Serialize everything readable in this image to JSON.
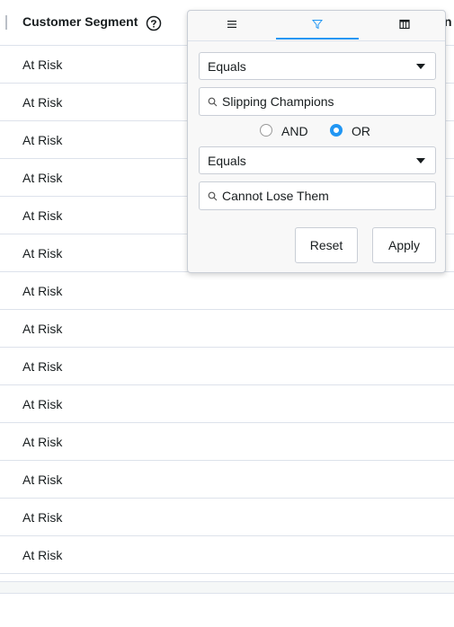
{
  "header": {
    "column_title": "Customer Segment",
    "next_column_partial": "n"
  },
  "rows": [
    "At Risk",
    "At Risk",
    "At Risk",
    "At Risk",
    "At Risk",
    "At Risk",
    "At Risk",
    "At Risk",
    "At Risk",
    "At Risk",
    "At Risk",
    "At Risk",
    "At Risk",
    "At Risk"
  ],
  "filter_popup": {
    "tabs": [
      {
        "icon": "menu-icon",
        "active": false
      },
      {
        "icon": "filter-icon",
        "active": true
      },
      {
        "icon": "columns-icon",
        "active": false
      }
    ],
    "condition1": {
      "operator": "Equals",
      "value": "Slipping Champions"
    },
    "join": {
      "and_label": "AND",
      "or_label": "OR",
      "selected": "OR"
    },
    "condition2": {
      "operator": "Equals",
      "value": "Cannot Lose Them"
    },
    "buttons": {
      "reset": "Reset",
      "apply": "Apply"
    }
  },
  "colors": {
    "accent": "#2196f3",
    "border": "#dde2eb"
  }
}
